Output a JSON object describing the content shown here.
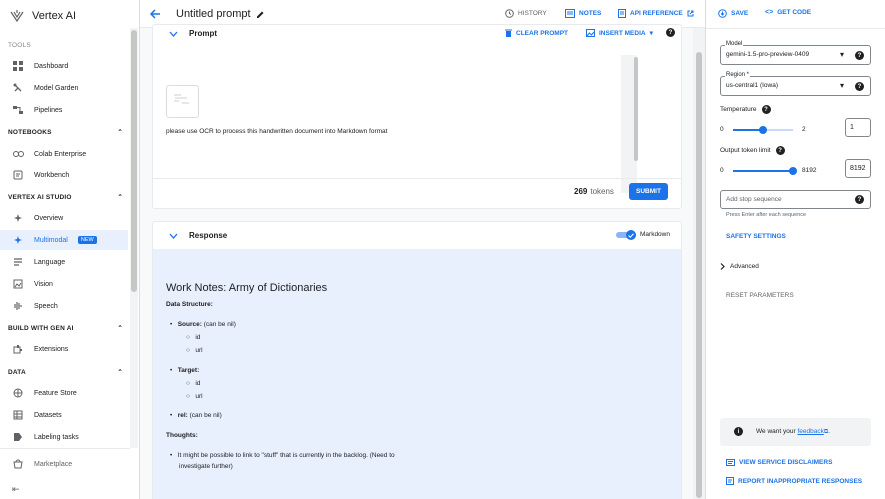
{
  "app": {
    "name": "Vertex AI"
  },
  "sidebar": {
    "tools_label": "TOOLS",
    "tools": [
      {
        "label": "Dashboard",
        "icon": "dashboard-icon"
      },
      {
        "label": "Model Garden",
        "icon": "model-garden-icon"
      },
      {
        "label": "Pipelines",
        "icon": "pipelines-icon"
      }
    ],
    "notebooks_label": "NOTEBOOKS",
    "notebooks": [
      {
        "label": "Colab Enterprise",
        "icon": "colab-icon"
      },
      {
        "label": "Workbench",
        "icon": "workbench-icon"
      }
    ],
    "studio_label": "VERTEX AI STUDIO",
    "studio": [
      {
        "label": "Overview",
        "icon": "overview-icon"
      },
      {
        "label": "Multimodal",
        "icon": "multimodal-icon",
        "badge": "NEW"
      },
      {
        "label": "Language",
        "icon": "language-icon"
      },
      {
        "label": "Vision",
        "icon": "vision-icon"
      },
      {
        "label": "Speech",
        "icon": "speech-icon"
      }
    ],
    "build_label": "BUILD WITH GEN AI",
    "build": [
      {
        "label": "Extensions",
        "icon": "extensions-icon"
      }
    ],
    "data_label": "DATA",
    "data": [
      {
        "label": "Feature Store",
        "icon": "feature-store-icon"
      },
      {
        "label": "Datasets",
        "icon": "datasets-icon"
      },
      {
        "label": "Labeling tasks",
        "icon": "labeling-icon"
      }
    ],
    "marketplace": "Marketplace"
  },
  "header": {
    "title": "Untitled prompt",
    "history": "HISTORY",
    "notes": "NOTES",
    "api_reference": "API REFERENCE",
    "save": "SAVE",
    "get_code": "GET CODE"
  },
  "prompt": {
    "label": "Prompt",
    "clear": "CLEAR PROMPT",
    "insert_media": "INSERT MEDIA",
    "text": "please use OCR to process this handwritten document into Markdown format",
    "tokens": "269",
    "tokens_label": "tokens",
    "submit": "SUBMIT"
  },
  "response": {
    "label": "Response",
    "markdown_toggle": "Markdown",
    "heading": "Work Notes: Army of Dictionaries",
    "data_structure": "Data Structure:",
    "source_label": "Source:",
    "source_note": "(can be nil)",
    "id": "id",
    "url": "url",
    "target_label": "Target:",
    "rel_label": "rel:",
    "rel_note": "(can be nil)",
    "thoughts": "Thoughts:",
    "thought_1a": "It might be possible to link to \"stuff\" that is currently in the backlog. (Need to",
    "thought_1b": "investigate further)"
  },
  "settings": {
    "model_label": "Model",
    "model_value": "gemini-1.5-pro-preview-0409",
    "region_label": "Region *",
    "region_value": "us-central1 (Iowa)",
    "temperature_label": "Temperature",
    "temp_min": "0",
    "temp_max": "2",
    "temp_value": "1",
    "temp_fraction": 0.5,
    "token_limit_label": "Output token limit",
    "token_min": "0",
    "token_max": "8192",
    "token_value": "8192",
    "token_fraction": 1.0,
    "stop_placeholder": "Add stop sequence",
    "stop_hint": "Press Enter after each sequence",
    "safety": "SAFETY SETTINGS",
    "advanced": "Advanced",
    "reset": "RESET PARAMETERS",
    "feedback_prefix": "We want your",
    "feedback_link": "feedback",
    "feedback_suffix": ".",
    "disclaimers": "VIEW SERVICE DISCLAIMERS",
    "report": "REPORT INAPPROPRIATE RESPONSES"
  },
  "colors": {
    "accent": "#1a73e8",
    "response_bg": "#e8f0fe"
  }
}
